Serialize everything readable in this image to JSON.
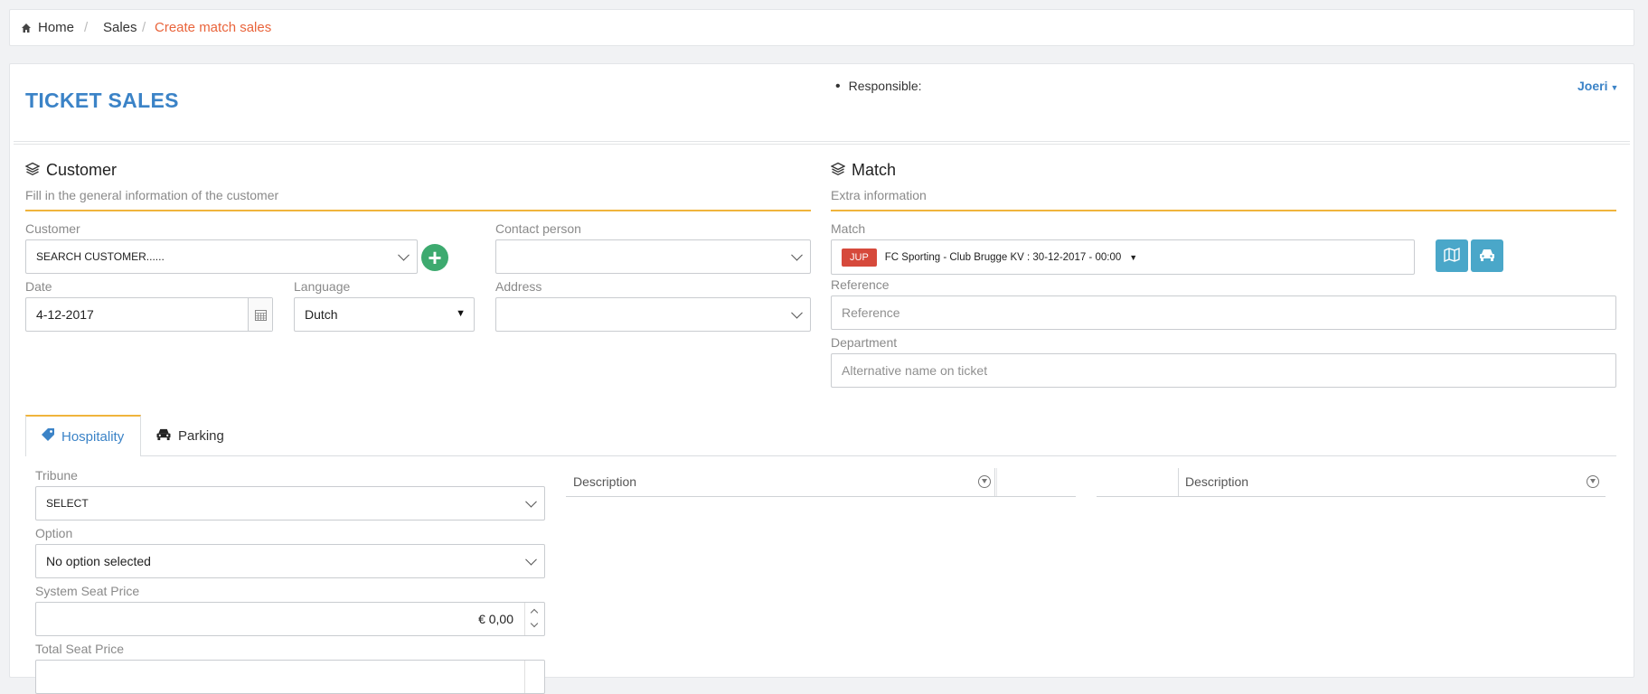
{
  "breadcrumb": {
    "home": "Home",
    "sales": "Sales",
    "current": "Create match sales",
    "sep": "/"
  },
  "header": {
    "title": "TICKET SALES",
    "responsible_label": "Responsible:",
    "user": "Joeri"
  },
  "customer": {
    "title": "Customer",
    "subtitle": "Fill in the general information of the customer",
    "customer_label": "Customer",
    "customer_value": "SEARCH CUSTOMER......",
    "contact_label": "Contact person",
    "contact_value": "",
    "date_label": "Date",
    "date_value": "4-12-2017",
    "language_label": "Language",
    "language_value": "Dutch",
    "address_label": "Address",
    "address_value": ""
  },
  "match": {
    "title": "Match",
    "subtitle": "Extra information",
    "match_label": "Match",
    "badge": "JUP",
    "match_value": "FC Sporting - Club Brugge KV : 30-12-2017 - 00:00",
    "reference_label": "Reference",
    "reference_placeholder": "Reference",
    "department_label": "Department",
    "department_placeholder": "Alternative name on ticket"
  },
  "tabs": [
    {
      "label": "Hospitality",
      "active": true
    },
    {
      "label": "Parking",
      "active": false
    }
  ],
  "hospitality": {
    "tribune_label": "Tribune",
    "tribune_value": "SELECT",
    "option_label": "Option",
    "option_value": "No option selected",
    "system_price_label": "System Seat Price",
    "system_price_value": "€ 0,00",
    "total_price_label": "Total Seat Price"
  },
  "grids": {
    "left_header": "Description",
    "right_header": "Description"
  },
  "colors": {
    "accent": "#3b83c7",
    "orange": "#e9643b",
    "yellow_line": "#f0b43c",
    "teal_button": "#4aa7c9",
    "green_plus": "#3daa6f",
    "badge_red": "#d6493b"
  },
  "icons": [
    "home-icon",
    "layers-icon",
    "calendar-icon",
    "map-icon",
    "car-icon",
    "tag-icon",
    "filter-icon",
    "plus-icon"
  ]
}
